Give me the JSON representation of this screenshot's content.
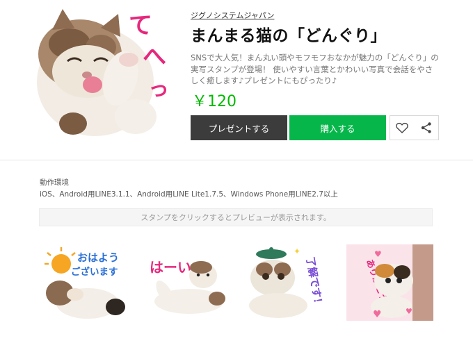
{
  "product": {
    "company": "ジグノシステムジャパン",
    "title": "まんまる猫の「どんぐり」",
    "description": "SNSで大人気！まん丸い頭やモフモフおなかが魅力の「どんぐり」の実写スタンプが登場！ 使いやすい言葉とかわいい写真で会話をやさしく癒します♪プレゼントにもぴったり♪",
    "price": "￥120",
    "main_sticker_text": "てへっ"
  },
  "buttons": {
    "present": "プレゼントする",
    "buy": "購入する"
  },
  "environment": {
    "label": "動作環境",
    "text": "iOS、Android用LINE3.1.1、Android用LINE Lite1.7.5、Windows Phone用LINE2.7以上"
  },
  "preview": {
    "hint": "スタンプをクリックするとプレビューが表示されます。"
  },
  "stickers": [
    {
      "text_line1": "おはよう",
      "text_line2": "ございます"
    },
    {
      "text_line1": "はーい"
    },
    {
      "text_line1": "了解です！"
    },
    {
      "text_line1": "ありがとう"
    }
  ],
  "colors": {
    "price": "#00b900",
    "buy_button": "#06b64a",
    "present_button": "#3c3c3c"
  }
}
